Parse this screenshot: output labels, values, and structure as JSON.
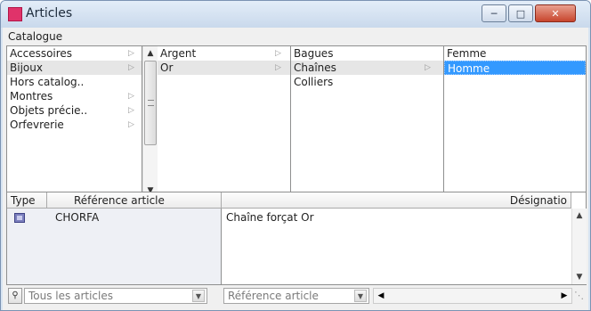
{
  "window": {
    "title": "Articles",
    "icons": {
      "minimize": "minimize-icon",
      "maximize": "maximize-icon",
      "close": "close-icon"
    }
  },
  "catalog": {
    "label": "Catalogue",
    "column1": [
      "Accessoires",
      "Bijoux",
      "Hors catalog..",
      "Montres",
      "Objets précie..",
      "Orfevrerie"
    ],
    "column2": [
      "Argent",
      "Or"
    ],
    "column3": [
      "Bagues",
      "Chaînes",
      "Colliers"
    ],
    "column4": [
      "Femme",
      "Homme"
    ]
  },
  "table": {
    "headers": [
      "Type",
      "Référence article",
      "Désignatio"
    ],
    "rows": [
      {
        "reference": "CHORFA",
        "designation": "Chaîne forçat Or"
      }
    ]
  },
  "footer": {
    "filter": "Tous les articles",
    "sort": "Référence article"
  },
  "colors": {
    "selection": "#3399ff",
    "accent": "#e0336a"
  }
}
